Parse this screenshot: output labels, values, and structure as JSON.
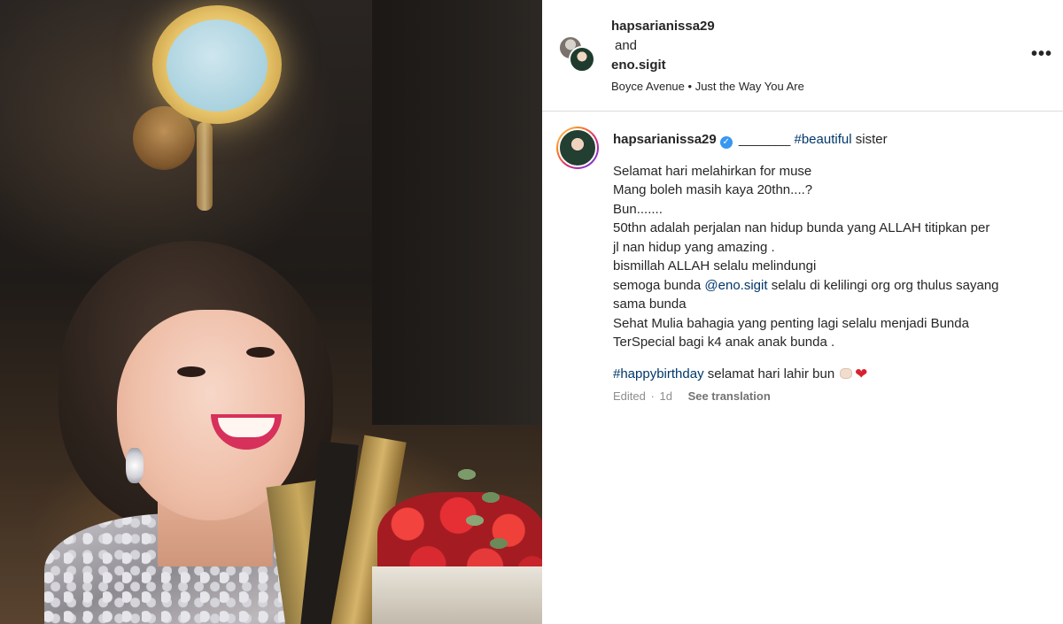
{
  "photo": {
    "description_alt": ""
  },
  "header": {
    "user1": "hapsarianissa29",
    "and_label": "and",
    "user2": "eno.sigit",
    "audio_artist": "Boyce Avenue",
    "audio_sep": "•",
    "audio_track": "Just the Way You Are",
    "more_icon": "more-options-icon"
  },
  "caption": {
    "username": "hapsarianissa29",
    "verified": "✓",
    "blank": "_______",
    "hashtag1": "#beautiful",
    "first_rest": "sister",
    "lines": [
      "Selamat hari melahirkan for muse",
      "Mang boleh masih kaya 20thn....?",
      "Bun.......",
      "50thn adalah perjalan nan hidup bunda yang ALLAH titipkan per",
      "jl nan hidup yang amazing .",
      "bismillah ALLAH selalu melindungi"
    ],
    "mention_prefix": "semoga bunda",
    "mention": "@eno.sigit",
    "mention_suffix": "selalu di kelilingi org org thulus sayang",
    "lines2": [
      "sama bunda",
      "Sehat Mulia bahagia yang penting lagi selalu menjadi Bunda",
      "TerSpecial bagi k4 anak anak bunda ."
    ],
    "hashtag2": "#happybirthday",
    "footer_text": "selamat hari lahir bun",
    "heart": "❤",
    "edited": "Edited",
    "dot": "·",
    "age": "1d",
    "see_translation": "See translation"
  },
  "colors": {
    "link": "#00376b",
    "verified": "#3897f0",
    "meta": "#8e8e8e",
    "divider": "#dbdbdb"
  }
}
